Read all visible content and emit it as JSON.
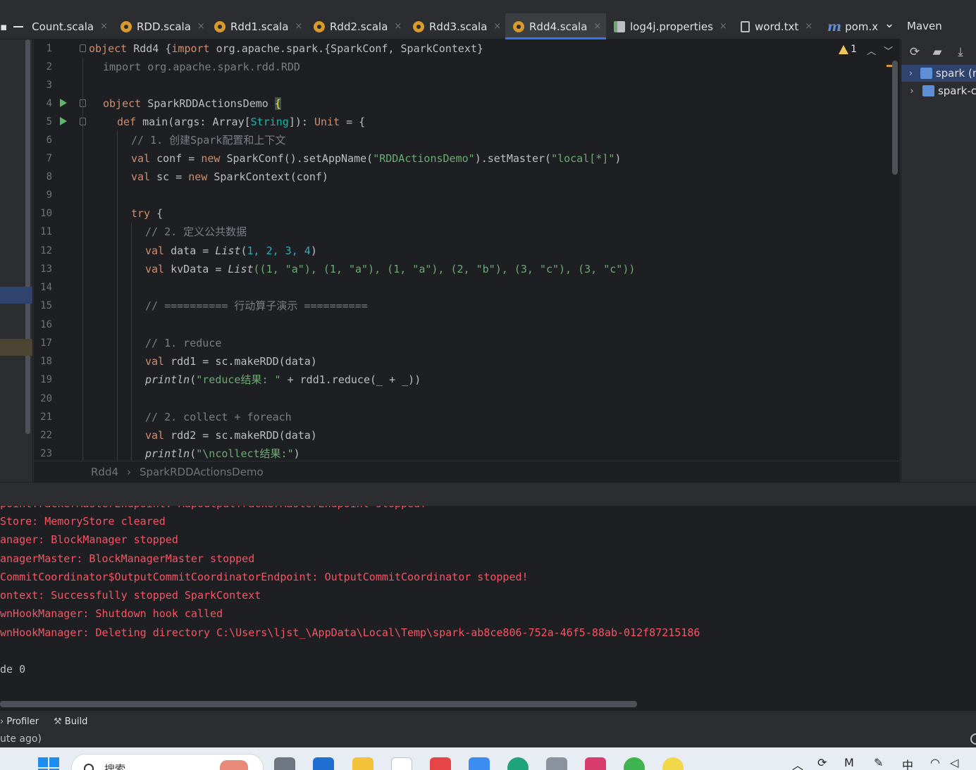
{
  "tabs": [
    {
      "label": "Count.scala",
      "icon": "file-icon",
      "active": false
    },
    {
      "label": "RDD.scala",
      "icon": "scala-file-icon",
      "active": false
    },
    {
      "label": "Rdd1.scala",
      "icon": "scala-file-icon",
      "active": false
    },
    {
      "label": "Rdd2.scala",
      "icon": "scala-file-icon",
      "active": false
    },
    {
      "label": "Rdd3.scala",
      "icon": "scala-file-icon",
      "active": false
    },
    {
      "label": "Rdd4.scala",
      "icon": "scala-file-icon",
      "active": true
    },
    {
      "label": "log4j.properties",
      "icon": "properties-file-icon",
      "active": false
    },
    {
      "label": "word.txt",
      "icon": "text-file-icon",
      "active": false
    },
    {
      "label": "pom.x",
      "icon": "maven-file-icon",
      "active": false
    }
  ],
  "close_glyph": "×",
  "tab_overflow_glyph": "⌄",
  "maven": {
    "title": "Maven",
    "items": [
      {
        "label": "spark (r",
        "selected": true
      },
      {
        "label": "spark-c",
        "selected": false
      }
    ]
  },
  "editor": {
    "warning_count": "1",
    "line_numbers": [
      "1",
      "2",
      "3",
      "4",
      "5",
      "6",
      "7",
      "8",
      "9",
      "10",
      "11",
      "12",
      "13",
      "14",
      "15",
      "16",
      "17",
      "18",
      "19",
      "20",
      "21",
      "22",
      "23"
    ],
    "code": {
      "l1_kw": "object",
      "l1_a": " Rdd4 {",
      "l1_kw2": "import",
      "l1_b": " org.apache.spark.{SparkConf, SparkContext}",
      "l2": "import org.apache.spark.rdd.RDD",
      "l4_kw": "object",
      "l4_name": " SparkRDDActionsDemo ",
      "l4_brace": "{",
      "l5_kw": "def",
      "l5_a": " main(args: Array[",
      "l5_t": "String",
      "l5_b": "]): ",
      "l5_kw2": "Unit",
      "l5_c": " = {",
      "l6": "// 1. 创建Spark配置和上下文",
      "l7_kw": "val",
      "l7_a": " conf = ",
      "l7_kw2": "new",
      "l7_b": " SparkConf().setAppName(",
      "l7_s1": "\"RDDActionsDemo\"",
      "l7_c": ").setMaster(",
      "l7_s2": "\"local[*]\"",
      "l7_d": ")",
      "l8_kw": "val",
      "l8_a": " sc = ",
      "l8_kw2": "new",
      "l8_b": " SparkContext(conf)",
      "l10_kw": "try",
      "l10_a": " {",
      "l11": "// 2. 定义公共数据",
      "l12_kw": "val",
      "l12_a": " data = ",
      "l12_list": "List",
      "l12_b": "(",
      "l12_n": "1, 2, 3, 4",
      "l12_c": ")",
      "l13_kw": "val",
      "l13_a": " kvData = ",
      "l13_list": "List",
      "l13_b": "((1, \"a\"), (1, \"a\"), (1, \"a\"), (2, \"b\"), (3, \"c\"), (3, \"c\"))",
      "l15": "// ========== 行动算子演示 ==========",
      "l17": "// 1. reduce",
      "l18_kw": "val",
      "l18_a": " rdd1 = sc.makeRDD(data)",
      "l19_fn": "println",
      "l19_a": "(",
      "l19_s": "\"reduce结果: \"",
      "l19_b": " + rdd1.reduce(_ + _))",
      "l21": "// 2. collect + foreach",
      "l22_kw": "val",
      "l22_a": " rdd2 = sc.makeRDD(data)",
      "l23_fn": "println",
      "l23_a": "(",
      "l23_s": "\"\\ncollect结果:\"",
      "l23_b": ")"
    }
  },
  "breadcrumb": [
    "Rdd4",
    "SparkRDDActionsDemo"
  ],
  "breadcrumb_sep": "›",
  "console": {
    "lines": [
      "pointTrackerMasterEndpoint: MapOutputTrackerMasterEndpoint stopped!",
      "Store: MemoryStore cleared",
      "anager: BlockManager stopped",
      "anagerMaster: BlockManagerMaster stopped",
      "CommitCoordinator$OutputCommitCoordinatorEndpoint: OutputCommitCoordinator stopped!",
      "ontext: Successfully stopped SparkContext",
      "wnHookManager: Shutdown hook called",
      "wnHookManager: Deleting directory C:\\Users\\ljst_\\AppData\\Local\\Temp\\spark-ab8ce806-752a-46f5-88ab-012f87215186",
      "",
      "de 0"
    ]
  },
  "tool_tabs": {
    "profiler": "Profiler",
    "build": "Build"
  },
  "status": {
    "text": "ute ago)"
  },
  "taskbar": {
    "search_placeholder": "搜索",
    "ime": "中"
  },
  "colors": {
    "accent": "#3574f0",
    "keyword": "#cf8e6d",
    "string": "#6aab73",
    "number": "#2aacb8",
    "comment": "#7a7e85",
    "error_text": "#f75464"
  }
}
